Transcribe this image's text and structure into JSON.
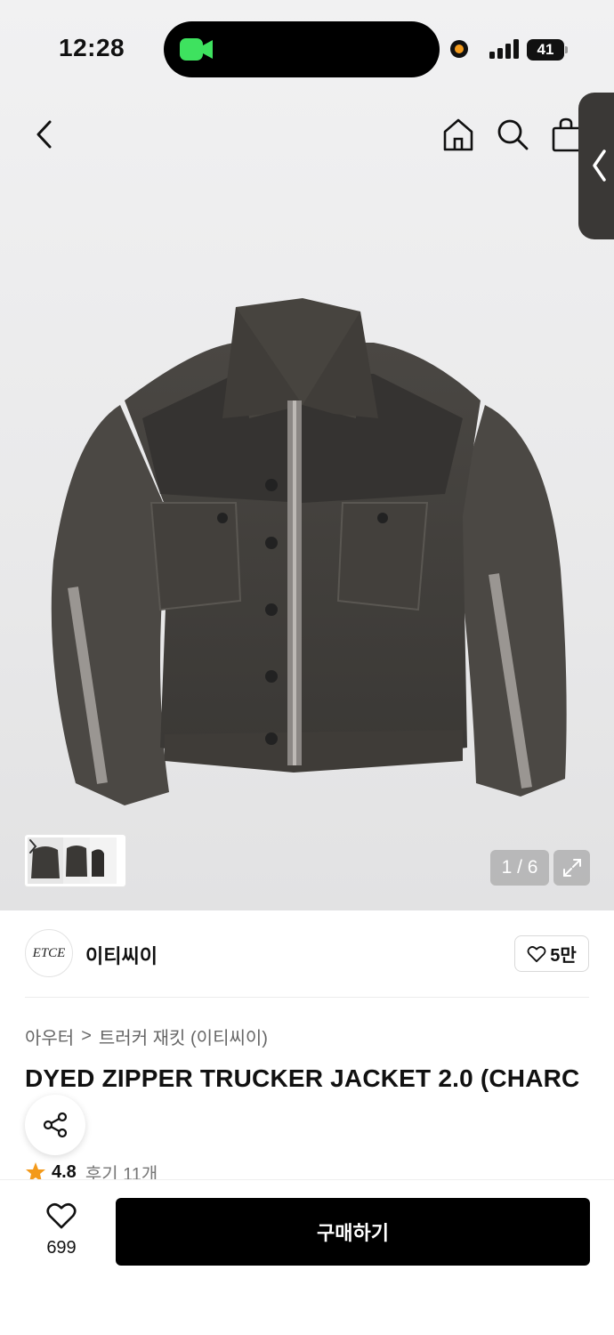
{
  "status_bar": {
    "time": "12:28",
    "battery": "41"
  },
  "icons": {
    "back": "chevron-left-icon",
    "home": "home-icon",
    "search": "search-icon",
    "bag": "shopping-bag-icon",
    "share": "share-icon",
    "heart": "heart-icon",
    "star": "star-icon",
    "expand": "expand-icon"
  },
  "gallery": {
    "counter": "1 / 6"
  },
  "brand": {
    "logo_text": "ETCE",
    "name": "이티씨이",
    "likes": "5만"
  },
  "breadcrumb": {
    "category": "아우터",
    "separator": ">",
    "subcategory": "트러커 재킷 (이티씨이)"
  },
  "product": {
    "title": "DYED ZIPPER TRUCKER JACKET 2.0 (CHARC",
    "rating": "4.8",
    "reviews": "후기 11개"
  },
  "bottom_bar": {
    "favorite_count": "699",
    "buy_label": "구매하기"
  },
  "colors": {
    "accent": "#000000",
    "star": "#f39a1b",
    "camera_green": "#3ee25f"
  }
}
